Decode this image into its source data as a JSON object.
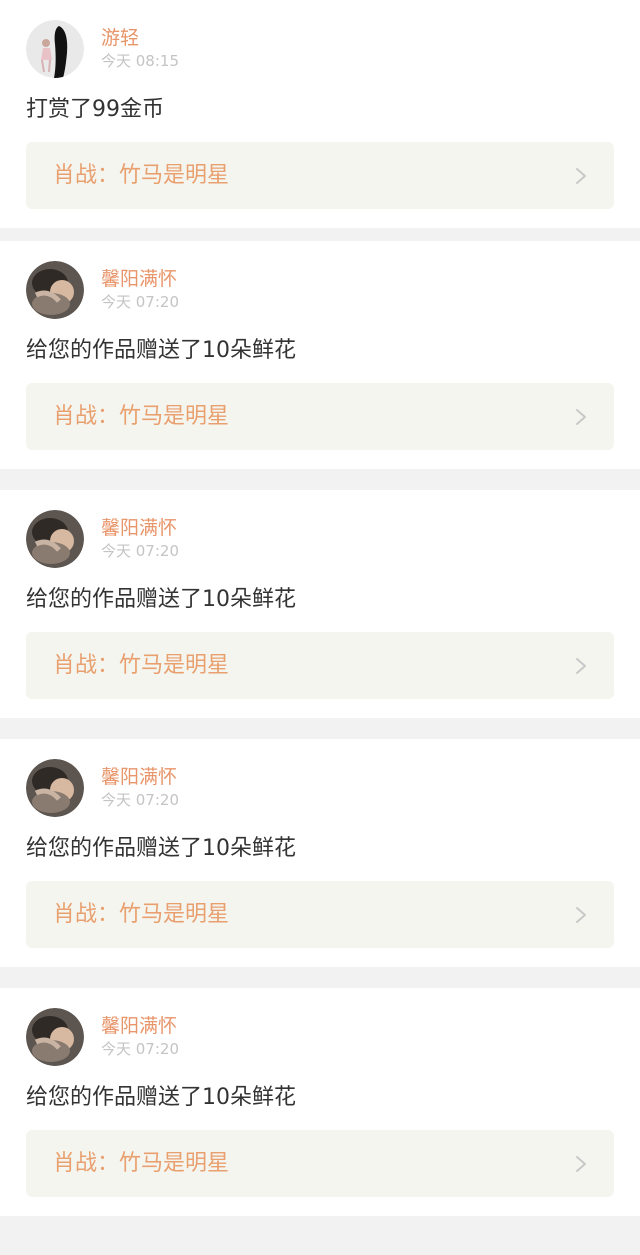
{
  "notifications": [
    {
      "avatar_icon": "girl-figure-avatar",
      "username": "游轻",
      "timestamp": "今天 08:15",
      "message": "打赏了99金币",
      "work_title": "肖战：竹马是明星",
      "chevron_icon": "chevron-right-icon"
    },
    {
      "avatar_icon": "photo-avatar",
      "username": "馨阳满怀",
      "timestamp": "今天 07:20",
      "message": "给您的作品赠送了10朵鲜花",
      "work_title": "肖战：竹马是明星",
      "chevron_icon": "chevron-right-icon"
    },
    {
      "avatar_icon": "photo-avatar",
      "username": "馨阳满怀",
      "timestamp": "今天 07:20",
      "message": "给您的作品赠送了10朵鲜花",
      "work_title": "肖战：竹马是明星",
      "chevron_icon": "chevron-right-icon"
    },
    {
      "avatar_icon": "photo-avatar",
      "username": "馨阳满怀",
      "timestamp": "今天 07:20",
      "message": "给您的作品赠送了10朵鲜花",
      "work_title": "肖战：竹马是明星",
      "chevron_icon": "chevron-right-icon"
    },
    {
      "avatar_icon": "photo-avatar",
      "username": "馨阳满怀",
      "timestamp": "今天 07:20",
      "message": "给您的作品赠送了10朵鲜花",
      "work_title": "肖战：竹马是明星",
      "chevron_icon": "chevron-right-icon"
    }
  ],
  "colors": {
    "background": "#f2f2f2",
    "card": "#ffffff",
    "username": "#e8956a",
    "timestamp": "#c4c4c4",
    "message": "#333333",
    "work_link_bg": "#f5f5f0",
    "work_title": "#e9a06f",
    "chevron": "#c8c8c8"
  }
}
